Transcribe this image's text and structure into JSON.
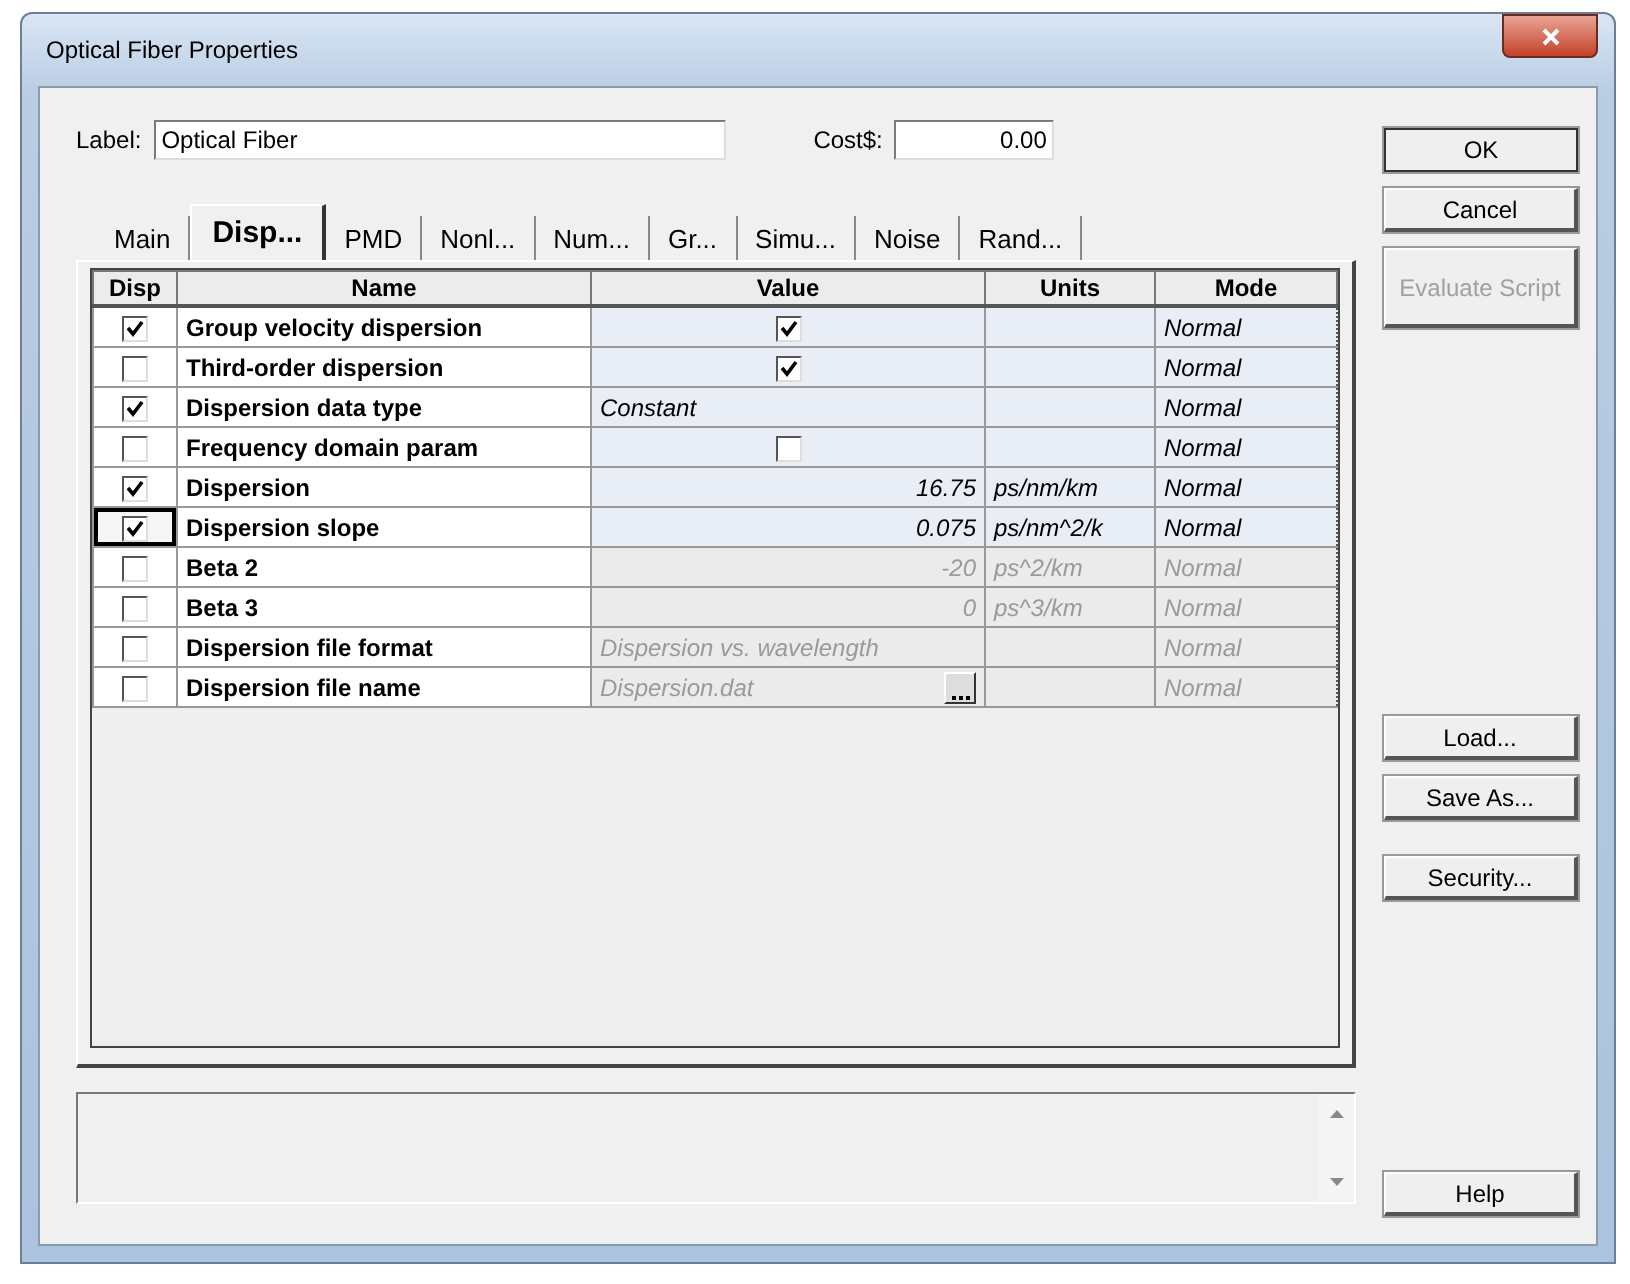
{
  "window": {
    "title": "Optical Fiber Properties"
  },
  "label_field": {
    "label": "Label:",
    "value": "Optical Fiber"
  },
  "cost_field": {
    "label": "Cost$:",
    "value": "0.00"
  },
  "tabs": [
    {
      "label": "Main",
      "selected": false
    },
    {
      "label": "Disp...",
      "selected": true
    },
    {
      "label": "PMD",
      "selected": false
    },
    {
      "label": "Nonl...",
      "selected": false
    },
    {
      "label": "Num...",
      "selected": false
    },
    {
      "label": "Gr...",
      "selected": false
    },
    {
      "label": "Simu...",
      "selected": false
    },
    {
      "label": "Noise",
      "selected": false
    },
    {
      "label": "Rand...",
      "selected": false
    }
  ],
  "table": {
    "columns": [
      "Disp",
      "Name",
      "Value",
      "Units",
      "Mode"
    ],
    "rows": [
      {
        "disp": true,
        "focused": false,
        "disabled": false,
        "name": "Group velocity dispersion",
        "kind": "check",
        "value_checked": true,
        "units": "",
        "mode": "Normal"
      },
      {
        "disp": false,
        "focused": false,
        "disabled": false,
        "name": "Third-order dispersion",
        "kind": "check",
        "value_checked": true,
        "units": "",
        "mode": "Normal"
      },
      {
        "disp": true,
        "focused": false,
        "disabled": false,
        "name": "Dispersion data type",
        "kind": "text",
        "value": "Constant",
        "units": "",
        "mode": "Normal"
      },
      {
        "disp": false,
        "focused": false,
        "disabled": false,
        "name": "Frequency domain param",
        "kind": "check",
        "value_checked": false,
        "units": "",
        "mode": "Normal"
      },
      {
        "disp": true,
        "focused": false,
        "disabled": false,
        "name": "Dispersion",
        "kind": "number",
        "value": "16.75",
        "units": "ps/nm/km",
        "mode": "Normal"
      },
      {
        "disp": true,
        "focused": true,
        "disabled": false,
        "name": "Dispersion slope",
        "kind": "number",
        "value": "0.075",
        "units": "ps/nm^2/k",
        "mode": "Normal"
      },
      {
        "disp": false,
        "focused": false,
        "disabled": true,
        "name": "Beta 2",
        "kind": "number",
        "value": "-20",
        "units": "ps^2/km",
        "mode": "Normal"
      },
      {
        "disp": false,
        "focused": false,
        "disabled": true,
        "name": "Beta 3",
        "kind": "number",
        "value": "0",
        "units": "ps^3/km",
        "mode": "Normal"
      },
      {
        "disp": false,
        "focused": false,
        "disabled": true,
        "name": "Dispersion file format",
        "kind": "text",
        "value": "Dispersion vs. wavelength",
        "units": "",
        "mode": "Normal"
      },
      {
        "disp": false,
        "focused": false,
        "disabled": true,
        "name": "Dispersion file name",
        "kind": "file",
        "value": "Dispersion.dat",
        "units": "",
        "mode": "Normal"
      }
    ]
  },
  "buttons_top": [
    {
      "label": "OK",
      "disabled": false
    },
    {
      "label": "Cancel",
      "disabled": false
    },
    {
      "label": "Evaluate Script",
      "disabled": true
    }
  ],
  "buttons_bottom": [
    {
      "label": "Load...",
      "disabled": false
    },
    {
      "label": "Save As...",
      "disabled": false
    },
    {
      "label": "Security...",
      "disabled": false
    }
  ],
  "help_button": {
    "label": "Help"
  }
}
